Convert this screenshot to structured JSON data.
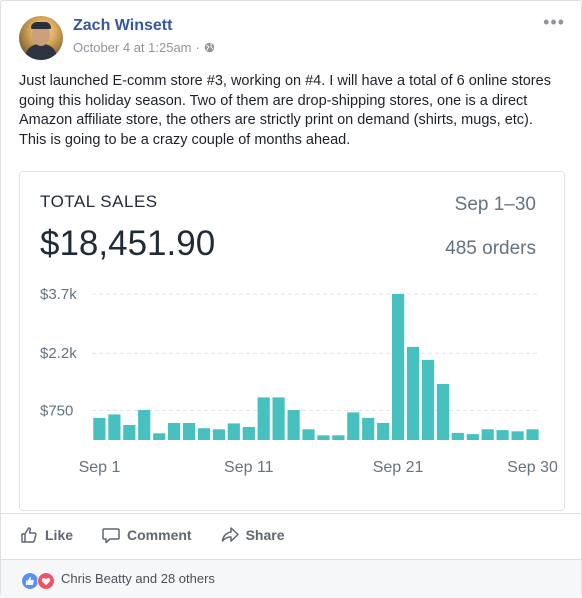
{
  "post": {
    "author": "Zach Winsett",
    "timestamp": "October 4 at 1:25am",
    "audience_icon": "globe-icon",
    "menu_icon": "more-options-icon",
    "text": "Just launched E-comm store #3, working on #4. I will have a total of 6 online stores going this holiday season. Two of them are drop-shipping stores, one is a direct Amazon affiliate store, the others are strictly print on demand (shirts, mugs, etc). This is going to be a crazy couple of months ahead."
  },
  "card": {
    "title": "TOTAL SALES",
    "period": "Sep 1–30",
    "total": "$18,451.90",
    "orders": "485 orders"
  },
  "chart_data": {
    "type": "bar",
    "title": "TOTAL SALES",
    "xlabel": "",
    "ylabel": "",
    "ytick_labels": [
      "$750",
      "$2.2k",
      "$3.7k"
    ],
    "yticks": [
      750,
      2200,
      3700
    ],
    "ylim": [
      0,
      3900
    ],
    "xtick_labels": [
      "Sep 1",
      "Sep 11",
      "Sep 21",
      "Sep 30"
    ],
    "xtick_index": [
      0,
      10,
      20,
      29
    ],
    "categories": [
      "Sep 1",
      "Sep 2",
      "Sep 3",
      "Sep 4",
      "Sep 5",
      "Sep 6",
      "Sep 7",
      "Sep 8",
      "Sep 9",
      "Sep 10",
      "Sep 11",
      "Sep 12",
      "Sep 13",
      "Sep 14",
      "Sep 15",
      "Sep 16",
      "Sep 17",
      "Sep 18",
      "Sep 19",
      "Sep 20",
      "Sep 21",
      "Sep 22",
      "Sep 23",
      "Sep 24",
      "Sep 25",
      "Sep 26",
      "Sep 27",
      "Sep 28",
      "Sep 29",
      "Sep 30"
    ],
    "values": [
      560,
      650,
      380,
      760,
      170,
      430,
      430,
      300,
      270,
      420,
      330,
      1080,
      1080,
      760,
      270,
      120,
      120,
      700,
      560,
      430,
      3700,
      2360,
      2030,
      1420,
      180,
      150,
      270,
      250,
      220,
      270
    ],
    "grid": true,
    "color": "#47c1bf",
    "grid_color": "#dfe3e8",
    "axis_text_color": "#637381"
  },
  "actions": {
    "like": "Like",
    "comment": "Comment",
    "share": "Share"
  },
  "reactions": {
    "text": "Chris Beatty and 28 others",
    "icons": [
      "like-reaction-icon",
      "love-reaction-icon"
    ],
    "like_color": "#5890ff",
    "love_color": "#f25268"
  }
}
